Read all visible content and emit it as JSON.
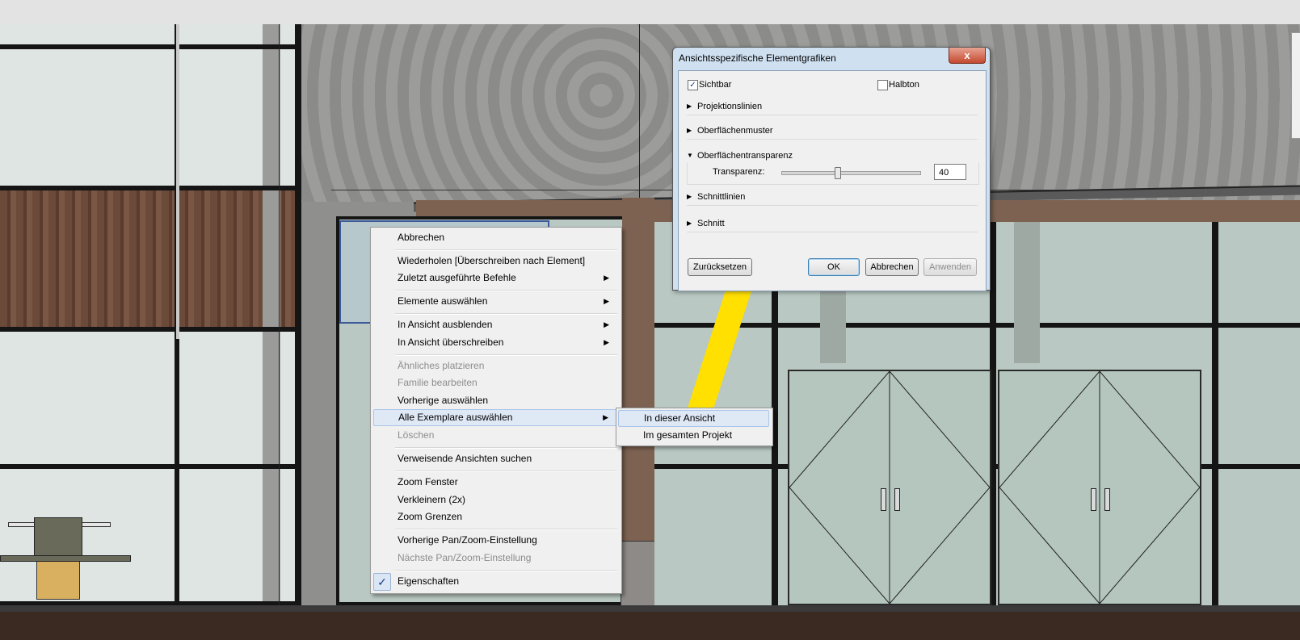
{
  "context_menu": {
    "items": [
      {
        "label": "Abbrechen",
        "enabled": true
      },
      {
        "label": "Wiederholen [Überschreiben nach Element]",
        "enabled": true
      },
      {
        "label": "Zuletzt ausgeführte Befehle",
        "enabled": true,
        "submenu": true
      },
      {
        "label": "Elemente auswählen",
        "enabled": true,
        "submenu": true
      },
      {
        "label": "In Ansicht ausblenden",
        "enabled": true,
        "submenu": true
      },
      {
        "label": "In Ansicht überschreiben",
        "enabled": true,
        "submenu": true
      },
      {
        "label": "Ähnliches platzieren",
        "enabled": false
      },
      {
        "label": "Familie bearbeiten",
        "enabled": false
      },
      {
        "label": "Vorherige auswählen",
        "enabled": true
      },
      {
        "label": "Alle Exemplare auswählen",
        "enabled": true,
        "submenu": true,
        "highlighted": true
      },
      {
        "label": "Löschen",
        "enabled": false
      },
      {
        "label": "Verweisende Ansichten suchen",
        "enabled": true
      },
      {
        "label": "Zoom Fenster",
        "enabled": true
      },
      {
        "label": "Verkleinern (2x)",
        "enabled": true
      },
      {
        "label": "Zoom Grenzen",
        "enabled": true
      },
      {
        "label": "Vorherige Pan/Zoom-Einstellung",
        "enabled": true
      },
      {
        "label": "Nächste Pan/Zoom-Einstellung",
        "enabled": false
      },
      {
        "label": "Eigenschaften",
        "enabled": true,
        "checked": true
      }
    ],
    "check_glyph": "✓",
    "arrow_glyph": "▶"
  },
  "submenu": {
    "items": [
      {
        "label": "In dieser Ansicht",
        "highlighted": true
      },
      {
        "label": "Im gesamten Projekt"
      }
    ]
  },
  "dialog": {
    "title": "Ansichtsspezifische Elementgrafiken",
    "close_glyph": "x",
    "visible_label": "Sichtbar",
    "visible_checked": true,
    "halftone_label": "Halbton",
    "halftone_checked": false,
    "sections": {
      "projection_lines": "Projektionslinien",
      "surface_patterns": "Oberflächenmuster",
      "surface_transparency": "Oberflächentransparenz",
      "cut_lines": "Schnittlinien",
      "cut_patterns": "Schnitt"
    },
    "transparency_label": "Transparenz:",
    "transparency_value": "40",
    "transparency_fraction": 0.4,
    "buttons": {
      "reset": "Zurücksetzen",
      "ok": "OK",
      "cancel": "Abbrechen",
      "apply": "Anwenden"
    }
  },
  "annotation": {
    "arrow_color": "#ffe000"
  }
}
